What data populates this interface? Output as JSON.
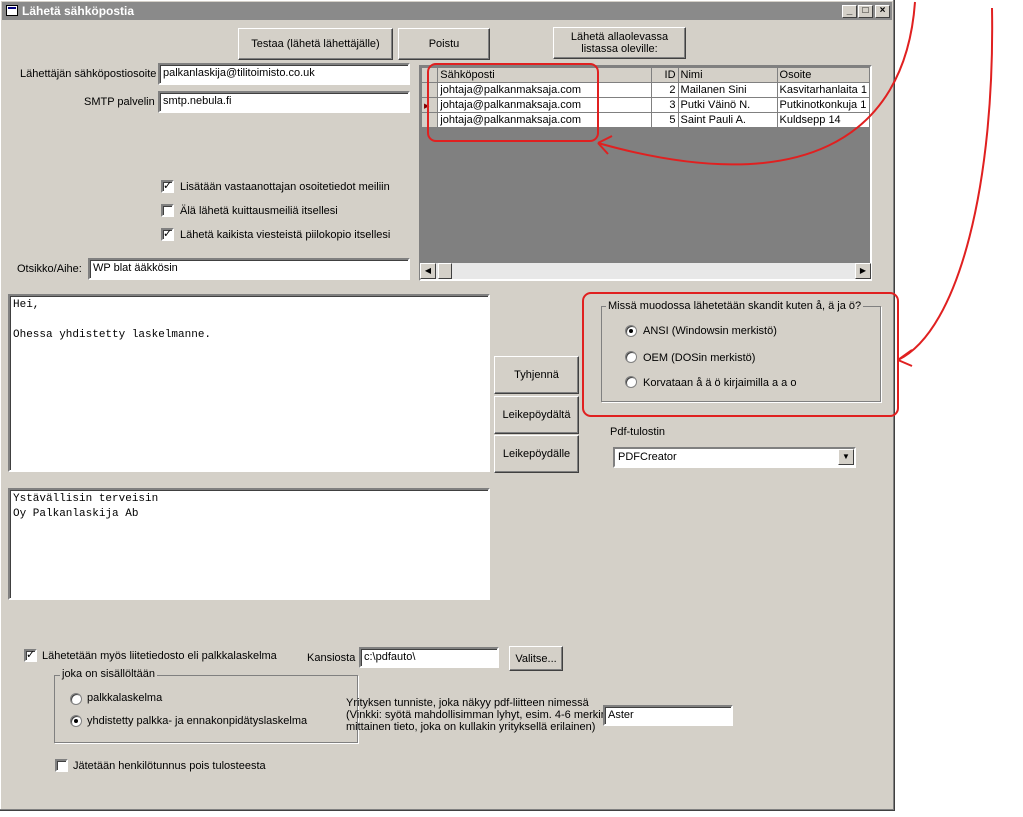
{
  "window": {
    "title": "Lähetä sähköpostia",
    "controls": {
      "minimize": "_",
      "maximize": "□",
      "close": "×"
    }
  },
  "toolbar": {
    "test_button": "Testaa (lähetä lähettäjälle)",
    "exit_button": "Poistu",
    "send_list_button_line1": "Lähetä allaolevassa",
    "send_list_button_line2": "listassa oleville:"
  },
  "sender": {
    "email_label": "Lähettäjän sähköpostiosoite",
    "email_value": "palkanlaskija@tilitoimisto.co.uk",
    "smtp_label": "SMTP palvelin",
    "smtp_value": "smtp.nebula.fi"
  },
  "options": {
    "add_address_info": {
      "label": "Lisätään vastaanottajan osoitetiedot meiliin",
      "checked": true
    },
    "no_receipt": {
      "label": "Älä lähetä kuittausmeiliä itsellesi",
      "checked": false
    },
    "bcc_self": {
      "label": "Lähetä kaikista viesteistä piilokopio itsellesi",
      "checked": true
    }
  },
  "subject": {
    "label": "Otsikko/Aihe:",
    "value": "WP blat ääkkösin"
  },
  "recipients": {
    "columns": [
      "Sähköposti",
      "ID",
      "Nimi",
      "Osoite"
    ],
    "rows": [
      {
        "email": "johtaja@palkanmaksaja.com",
        "id": "2",
        "name": "Mailanen Sini",
        "address": "Kasvitarhanlaita 1"
      },
      {
        "email": "johtaja@palkanmaksaja.com",
        "id": "3",
        "name": "Putki Väinö N.",
        "address": "Putkinotkonkuja 1"
      },
      {
        "email": "johtaja@palkanmaksaja.com",
        "id": "5",
        "name": "Saint Pauli A.",
        "address": "Kuldsepp 14"
      }
    ],
    "current_row_indicator": "▶"
  },
  "body": {
    "message": "Hei,\n\nOhessa yhdistetty laskelmanne.",
    "signature": "Ystävällisin terveisin\nOy Palkanlaskija Ab"
  },
  "clipboard": {
    "clear_button": "Tyhjennä",
    "from_clipboard_button": "Leikepöydältä",
    "to_clipboard_button": "Leikepöydälle"
  },
  "charset": {
    "group_label": "Missä muodossa lähetetään skandit kuten å, ä ja ö?",
    "options": [
      {
        "label": "ANSI (Windowsin merkistö)",
        "selected": true
      },
      {
        "label": "OEM (DOSin merkistö)",
        "selected": false
      },
      {
        "label": "Korvataan å ä ö kirjaimilla a a o",
        "selected": false
      }
    ]
  },
  "pdf": {
    "printer_label": "Pdf-tulostin",
    "printer_value": "PDFCreator"
  },
  "attachment": {
    "send_attachment": {
      "label": "Lähetetään myös liitetiedosto eli palkkalaskelma",
      "checked": true
    },
    "folder_label": "Kansiosta",
    "folder_value": "c:\\pdfauto\\",
    "browse_button": "Valitse...",
    "contents_group_label": "joka on sisällöltään",
    "contents_options": [
      {
        "label": "palkkalaskelma",
        "selected": false
      },
      {
        "label": "yhdistetty palkka- ja ennakonpidätyslaskelma",
        "selected": true
      }
    ],
    "company_id_help_line1": "Yrityksen tunniste, joka näkyy pdf-liitteen nimessä",
    "company_id_help_line2": "(Vinkki: syötä mahdollisimman lyhyt, esim. 4-6 merkin",
    "company_id_help_line3": "mittainen tieto, joka on kullakin yrityksellä erilainen)",
    "company_id_value": "Aster",
    "omit_ssn": {
      "label": "Jätetään henkilötunnus pois tulosteesta",
      "checked": false
    }
  },
  "annotation_color": "#e02020",
  "icons": [
    "window-icon",
    "dropdown-arrow-icon",
    "scroll-left-icon",
    "scroll-right-icon",
    "row-indicator-icon"
  ]
}
